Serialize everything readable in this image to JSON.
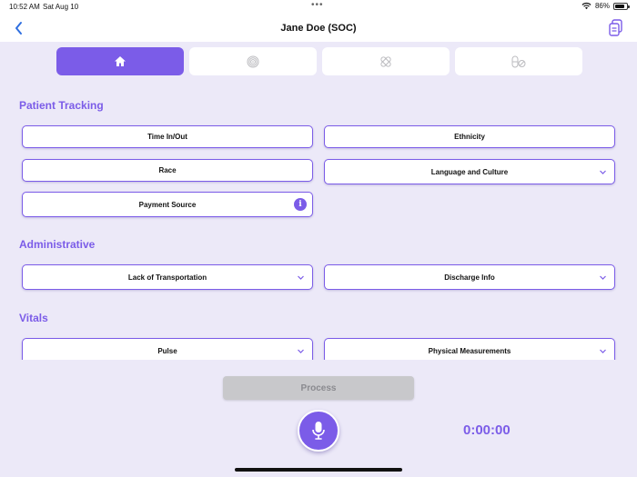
{
  "status_bar": {
    "time": "10:52 AM",
    "date": "Sat Aug 10",
    "battery": "86%",
    "battery_level": 0.86,
    "wifi_icon": "wifi-icon"
  },
  "nav": {
    "title": "Jane Doe (SOC)",
    "back_icon": "chevron-left-icon",
    "doc_icon": "documents-icon"
  },
  "tabs": [
    {
      "icon": "home-icon",
      "active": true
    },
    {
      "icon": "fingerprint-icon",
      "active": false
    },
    {
      "icon": "bandage-icon",
      "active": false
    },
    {
      "icon": "pills-icon",
      "active": false
    }
  ],
  "sections": {
    "patient_tracking": {
      "title": "Patient Tracking",
      "fields": {
        "time_in_out": "Time In/Out",
        "ethnicity": "Ethnicity",
        "race": "Race",
        "language_culture": "Language and Culture",
        "payment_source": "Payment Source"
      }
    },
    "administrative": {
      "title": "Administrative",
      "fields": {
        "lack_transportation": "Lack of Transportation",
        "discharge_info": "Discharge Info"
      }
    },
    "vitals": {
      "title": "Vitals",
      "fields": {
        "pulse": "Pulse",
        "physical_measurements": "Physical Measurements"
      }
    }
  },
  "footer": {
    "process_label": "Process",
    "timer": "0:00:00"
  },
  "colors": {
    "accent": "#7b5ce8",
    "background": "#ece9f8"
  }
}
